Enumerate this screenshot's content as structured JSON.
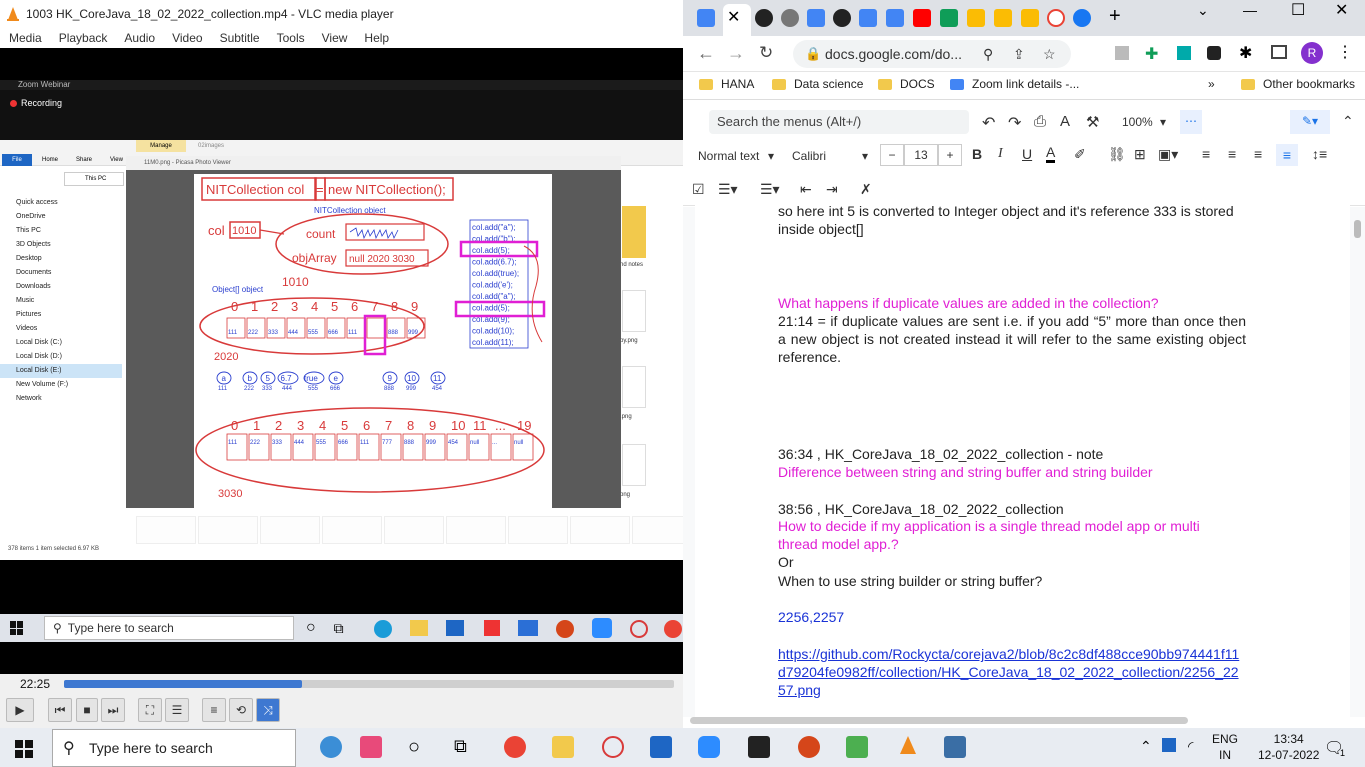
{
  "vlc": {
    "title": "1003 HK_CoreJava_18_02_2022_collection.mp4 - VLC media player",
    "menu": [
      "Media",
      "Playback",
      "Audio",
      "Video",
      "Subtitle",
      "Tools",
      "View",
      "Help"
    ],
    "time": "22:25",
    "progress": 0.39
  },
  "zoom": {
    "title": "Zoom Webinar",
    "recording": "Recording"
  },
  "explorer": {
    "tab_manage": "Manage",
    "tab_images": "02images",
    "menu": [
      "File",
      "Home",
      "Share",
      "View"
    ],
    "crumb_pc": "This PC",
    "sidebar": [
      "Quick access",
      "OneDrive",
      "This PC",
      "3D Objects",
      "Desktop",
      "Documents",
      "Downloads",
      "Music",
      "Pictures",
      "Videos",
      "Local Disk (C:)",
      "Local Disk (D:)",
      "Local Disk (E:)",
      "New Volume (F:)",
      "Network"
    ],
    "status": "378 items    1 item selected  6.97 KB",
    "file_labels": [
      "nd notes",
      "py.png",
      ".png",
      "png"
    ]
  },
  "picasa": {
    "title": "11M0.png - Picasa Photo Viewer"
  },
  "slide": {
    "header_left": "NITCollection col",
    "header_eq": "=",
    "header_right": "new NITCollection();",
    "nitobj": "NITCollection object",
    "col": "col",
    "ref1010": "1010",
    "count": "count",
    "objArray": "objArray",
    "objArrayVal": "null 2020 3030",
    "lbl1010": "1010",
    "objectobj": "Object[] object",
    "idx1": [
      "0",
      "1",
      "2",
      "3",
      "4",
      "5",
      "6",
      "7",
      "8",
      "9"
    ],
    "vals1": [
      "111",
      "222",
      "333",
      "444",
      "555",
      "666",
      "111",
      "",
      "888",
      "999"
    ],
    "lbl2020": "2020",
    "bubbles": [
      "a",
      "b",
      "5",
      "6.7",
      "true",
      "e",
      "9",
      "10",
      "11"
    ],
    "bubblevals": [
      "111",
      "222",
      "333",
      "444",
      "555",
      "666",
      "888",
      "999",
      "454"
    ],
    "idx2": [
      "0",
      "1",
      "2",
      "3",
      "4",
      "5",
      "6",
      "7",
      "8",
      "9",
      "10",
      "11",
      "...",
      "19"
    ],
    "vals2": [
      "111",
      "222",
      "333",
      "444",
      "555",
      "666",
      "111",
      "777",
      "888",
      "999",
      "454",
      "null",
      "...",
      "null"
    ],
    "lbl3030": "3030",
    "adds": [
      "col.add(\"a\");",
      "col.add(\"b\");",
      "col.add(5);",
      "col.add(6.7);",
      "col.add(true);",
      "col.add('e');",
      "col.add(\"a\");",
      "col.add(5);",
      "col.add(9);",
      "col.add(10);",
      "col.add(11);"
    ]
  },
  "innertaskbar": {
    "search": "Type here to search"
  },
  "chrome": {
    "url": "docs.google.com/do...",
    "bookmarks": [
      "HANA",
      "Data science",
      "DOCS",
      "Zoom link details -...",
      "Other bookmarks"
    ],
    "menu_search": "Search the menus (Alt+/)",
    "zoom": "100%",
    "style": "Normal text",
    "font": "Calibri",
    "size": "13",
    "profile": "R"
  },
  "doc": {
    "line1": "so here int 5 is converted to Integer object and it's reference 333 is stored",
    "line2": "inside object[]",
    "q1": "What happens if duplicate values are added in the collection?",
    "a1": "21:14 = if duplicate values are sent i.e. if you add “5” more than once then a new object is not created instead it will refer to the same existing object reference.",
    "n1": "36:34 ,  HK_CoreJava_18_02_2022_collection - note",
    "n1b": "Difference between string and string buffer and string builder",
    "n2": "38:56 ,  HK_CoreJava_18_02_2022_collection",
    "n2b": "How to decide if my application is a single thread model app or multi thread model app.?",
    "or": "Or",
    "n2c": "When to use string builder or string buffer?",
    "nums": "2256,2257",
    "link": "https://github.com/Rockycta/corejava2/blob/8c2c8df488cce90bb974441f11d79204fe0982ff/collection/HK_CoreJava_18_02_2022_collection/2256_2257.png"
  },
  "taskbar": {
    "search": "Type here to search",
    "lang1": "ENG",
    "lang2": "IN",
    "time": "13:34",
    "date": "12-07-2022",
    "notif": "1"
  },
  "colors": {
    "accent": "#1a73e8",
    "magenta": "#e01fd4",
    "slide_red": "#d83a3a",
    "slide_blue": "#2b3fcf"
  }
}
